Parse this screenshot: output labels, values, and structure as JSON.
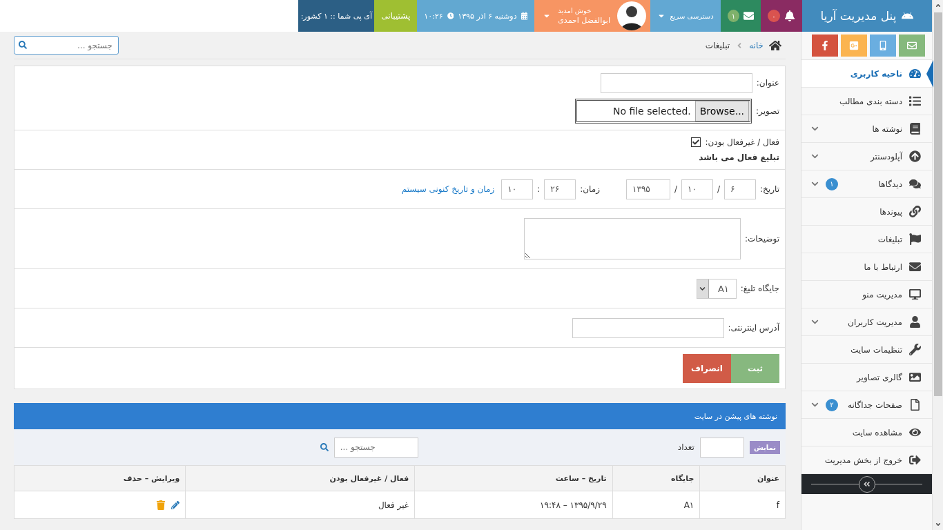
{
  "topbar": {
    "brand": "پنل مدیریت آریا",
    "notifications_badge": "۰",
    "messages_badge": "۱",
    "quick_access": "دسترسی سریع",
    "user": {
      "greeting": "خوش امدید",
      "name": "ابوالفضل احمدی"
    },
    "date": "دوشنبه ۶ اذر ۱۳۹۵",
    "time": "۱۰:۲۶",
    "support": "پشتیبانی",
    "ip": "آی پی شما :: ۱ کشور:"
  },
  "social": [
    {
      "kind": "mail"
    },
    {
      "kind": "mobile"
    },
    {
      "kind": "gplus"
    },
    {
      "kind": "facebook"
    }
  ],
  "sidebar": {
    "items": [
      {
        "label": "ناحیه کاربری",
        "selected": true,
        "expandable": false
      },
      {
        "label": "دسته بندی مطالب",
        "selected": false,
        "expandable": false
      },
      {
        "label": "نوشته ها",
        "selected": false,
        "expandable": true
      },
      {
        "label": "آپلودسنتر",
        "selected": false,
        "expandable": true
      },
      {
        "label": "دیدگاها",
        "selected": false,
        "expandable": true,
        "badge": "۱"
      },
      {
        "label": "پیوندها",
        "selected": false,
        "expandable": false
      },
      {
        "label": "تبلیغات",
        "selected": false,
        "expandable": false
      },
      {
        "label": "ارتباط با ما",
        "selected": false,
        "expandable": false
      },
      {
        "label": "مدیریت منو",
        "selected": false,
        "expandable": false
      },
      {
        "label": "مدیریت کاربران",
        "selected": false,
        "expandable": true
      },
      {
        "label": "تنظیمات سایت",
        "selected": false,
        "expandable": false
      },
      {
        "label": "گالری تصاویر",
        "selected": false,
        "expandable": false
      },
      {
        "label": "صفحات جداگانه",
        "selected": false,
        "expandable": true,
        "badge": "۲"
      },
      {
        "label": "مشاهده سایت",
        "selected": false,
        "expandable": false
      },
      {
        "label": "خروج از بخش مدیریت",
        "selected": false,
        "expandable": false
      }
    ]
  },
  "breadcrumb": {
    "home": "خانه",
    "current": "تبلیغات"
  },
  "search": {
    "placeholder": "جستجو ..."
  },
  "form": {
    "title_label": "عنوان:",
    "image_label": "تصویر:",
    "file_button": "Browse...",
    "file_status": "No file selected.",
    "active_label": "فعال / غیرفعال بودن:",
    "active_checked": true,
    "active_note": "تبلیغ فعال می باشد",
    "date_label": "تاریخ:",
    "date_fields": [
      "۶",
      "۱۰",
      "۱۳۹۵"
    ],
    "date_separator": "/",
    "time_label": "زمان:",
    "time_fields": [
      "۲۶",
      "۱۰"
    ],
    "time_separator": ":",
    "system_time_link": "زمان و تاریخ کنونی سیستم",
    "description_label": "توضیحات:",
    "position_label": "جایگاه تلیغ:",
    "position_value": "A۱",
    "url_label": "آدرس اینترنتی:",
    "submit": "ثبت",
    "cancel": "انصراف"
  },
  "posts": {
    "title": "نوشته های پیشن در سایت",
    "show_button": "نمایش",
    "count_label": "تعداد",
    "search_placeholder": "جستجو ...",
    "columns": [
      "عنوان",
      "جایگاه",
      "تاریخ – ساعت",
      "فعال / غیرفعال بودن",
      "ویرایش – حذف"
    ],
    "rows": [
      {
        "title": "f",
        "position": "A۱",
        "datetime": "۱۳۹۵/۹/۲۹ – ۱۹:۴۸",
        "status": "غیر فعال"
      }
    ]
  }
}
